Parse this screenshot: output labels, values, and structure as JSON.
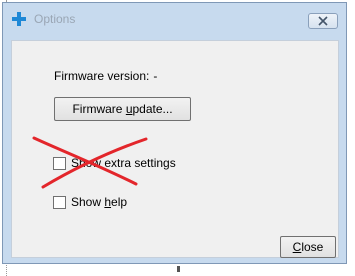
{
  "window": {
    "title": "Options",
    "close_glyph": "×",
    "accent": "#1e88d6"
  },
  "firmware": {
    "version_label": "Firmware version:",
    "version_value": "-",
    "update_button": {
      "prefix": "Firmware ",
      "accel": "u",
      "suffix": "pdate..."
    }
  },
  "options": {
    "show_extra_settings": {
      "text": "Show extra settings",
      "checked": false,
      "strikethrough_color": "#e3262b"
    },
    "show_help": {
      "prefix": "Show ",
      "accel": "h",
      "suffix": "elp",
      "checked": false
    }
  },
  "footer": {
    "close_button": {
      "accel": "C",
      "suffix": "lose"
    }
  }
}
